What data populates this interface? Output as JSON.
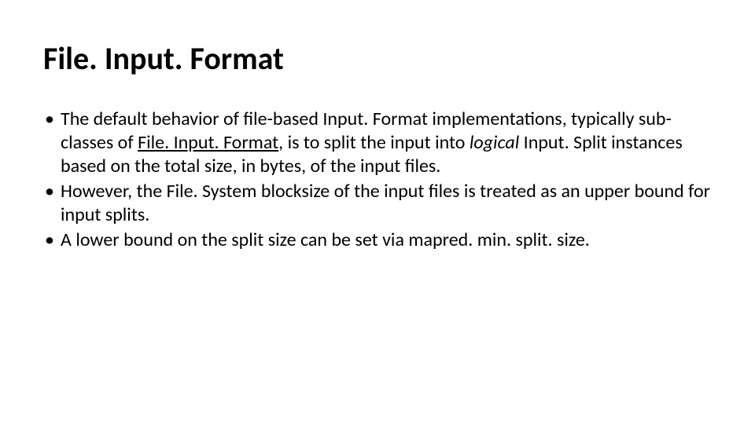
{
  "title": "File. Input. Format",
  "bullets": [
    {
      "pre": "The default behavior of file-based Input. Format implementations, typically sub-classes of ",
      "link": "File. Input. Format",
      "mid1": ", is to split the input into ",
      "ital": "logical",
      "post": " Input. Split instances based on the total size, in bytes, of the input files."
    },
    {
      "text": "However, the File. System blocksize of the input files is treated as an upper bound for input splits."
    },
    {
      "text": "A lower bound on the split size can be set via mapred. min. split. size."
    }
  ]
}
